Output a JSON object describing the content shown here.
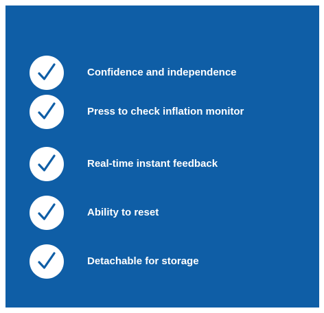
{
  "features": {
    "items": [
      {
        "label": "Confidence and independence",
        "icon": "checkmark-icon"
      },
      {
        "label": "Press to check inflation monitor",
        "icon": "checkmark-icon"
      },
      {
        "label": "Real-time instant feedback",
        "icon": "checkmark-icon"
      },
      {
        "label": "Ability to reset",
        "icon": "checkmark-icon"
      },
      {
        "label": "Detachable for storage",
        "icon": "checkmark-icon"
      }
    ]
  },
  "colors": {
    "panel_background": "#0f5ea6",
    "check_circle": "#ffffff",
    "check_mark": "#0f5ea6",
    "label_text": "#ffffff"
  }
}
